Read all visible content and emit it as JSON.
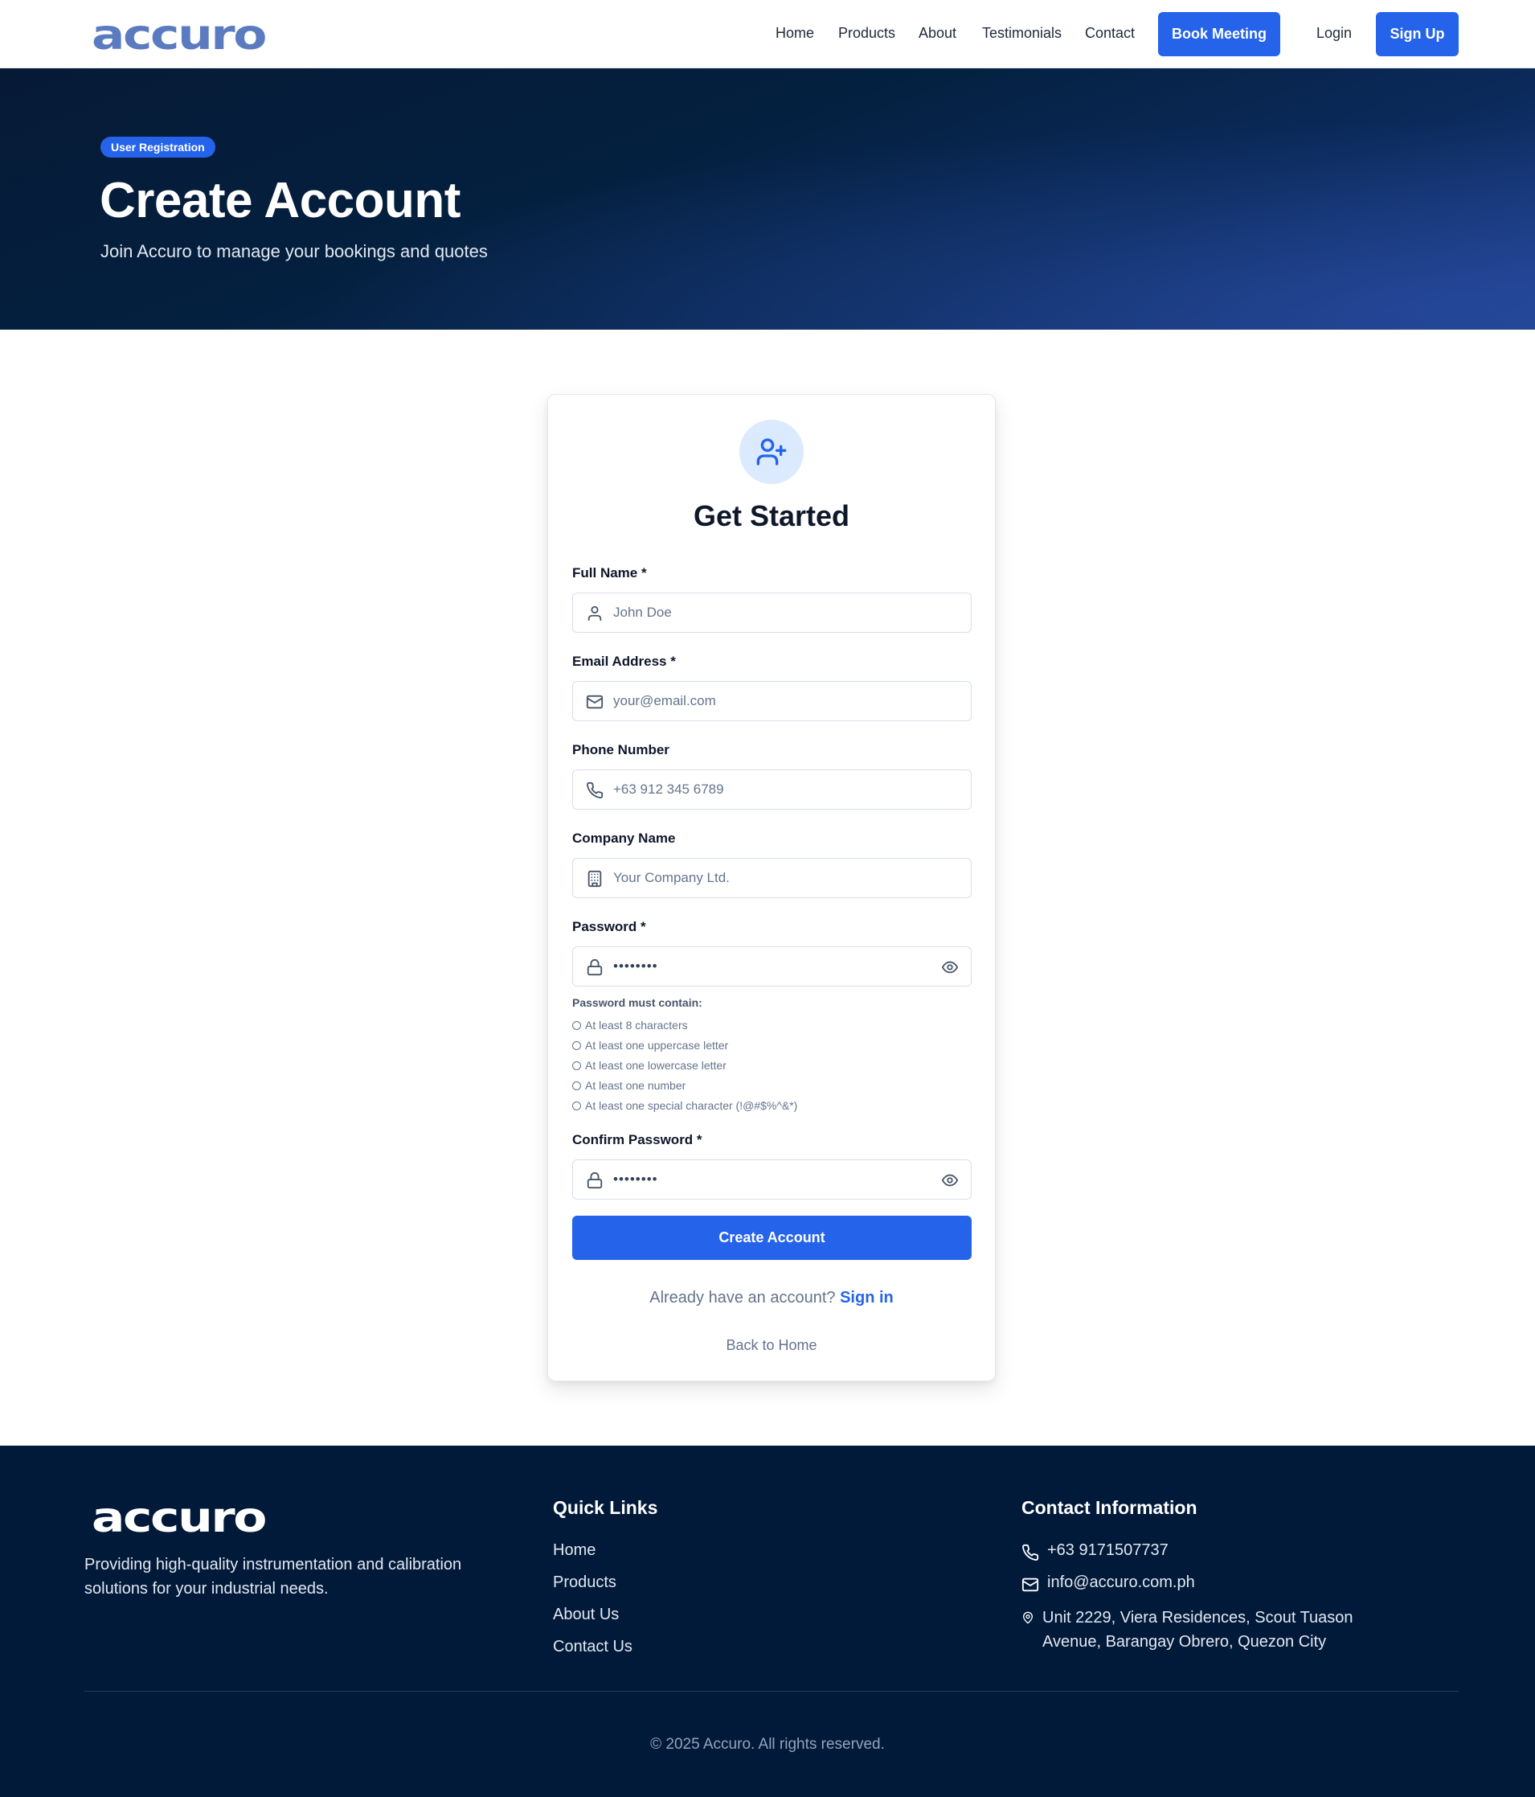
{
  "brand": {
    "logo_text": "accuro",
    "primary_color": "#2563eb",
    "dark_color": "#021a3a"
  },
  "nav": {
    "links": [
      "Home",
      "Products",
      "About",
      "Testimonials",
      "Contact"
    ],
    "book_meeting": "Book Meeting",
    "login": "Login",
    "signup": "Sign Up"
  },
  "hero": {
    "badge": "User Registration",
    "title": "Create Account",
    "subtitle": "Join Accuro to manage your bookings and quotes"
  },
  "form": {
    "title": "Get Started",
    "avatar_icon": "user-plus-icon",
    "fields": {
      "full_name": {
        "label": "Full Name *",
        "placeholder": "John Doe",
        "icon": "user-icon"
      },
      "email": {
        "label": "Email Address *",
        "placeholder": "your@email.com",
        "icon": "mail-icon"
      },
      "phone": {
        "label": "Phone Number",
        "placeholder": "+63 912 345 6789",
        "icon": "phone-icon"
      },
      "company": {
        "label": "Company Name",
        "placeholder": "Your Company Ltd.",
        "icon": "building-icon"
      },
      "password": {
        "label": "Password *",
        "placeholder": "••••••••",
        "icon": "lock-icon"
      },
      "confirm_password": {
        "label": "Confirm Password *",
        "placeholder": "••••••••",
        "icon": "lock-icon"
      }
    },
    "password_requirements": {
      "title": "Password must contain:",
      "items": [
        "At least 8 characters",
        "At least one uppercase letter",
        "At least one lowercase letter",
        "At least one number",
        "At least one special character (!@#$%^&*)"
      ]
    },
    "submit_label": "Create Account",
    "signin_prompt": "Already have an account?",
    "signin_link": "Sign in",
    "back_home": "Back to Home"
  },
  "footer": {
    "logo_text": "accuro",
    "description": "Providing high-quality instrumentation and calibration solutions for your industrial needs.",
    "quick_links_title": "Quick Links",
    "quick_links": [
      "Home",
      "Products",
      "About Us",
      "Contact Us"
    ],
    "contact_title": "Contact Information",
    "phone": "+63 9171507737",
    "email": "info@accuro.com.ph",
    "address": "Unit 2229, Viera Residences, Scout Tuason Avenue, Barangay Obrero, Quezon City",
    "copyright": "© 2025 Accuro. All rights reserved."
  }
}
